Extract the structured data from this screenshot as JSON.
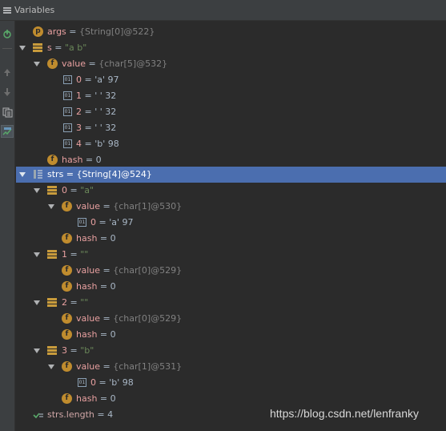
{
  "panel": {
    "title": "Variables"
  },
  "toolbar": {
    "icons": [
      "add-watch-icon",
      "up-arrow-icon",
      "down-arrow-icon",
      "copy-icon",
      "watches-icon"
    ]
  },
  "rows": {
    "args": {
      "name": "args",
      "eq": " = ",
      "value": "{String[0]@522}"
    },
    "s": {
      "name": "s",
      "eq": " = ",
      "value": "\"a  b\""
    },
    "s_value": {
      "name": "value",
      "eq": " = ",
      "value": "{char[5]@532}"
    },
    "s_v0": {
      "name": "0",
      "eq": " = ",
      "value": "'a' 97"
    },
    "s_v1": {
      "name": "1",
      "eq": " = ",
      "value": "' ' 32"
    },
    "s_v2": {
      "name": "2",
      "eq": " = ",
      "value": "' ' 32"
    },
    "s_v3": {
      "name": "3",
      "eq": " = ",
      "value": "' ' 32"
    },
    "s_v4": {
      "name": "4",
      "eq": " = ",
      "value": "'b' 98"
    },
    "s_hash": {
      "name": "hash",
      "eq": " = ",
      "value": "0"
    },
    "strs": {
      "name": "strs",
      "eq": " = ",
      "value": "{String[4]@524}"
    },
    "strs0": {
      "name": "0",
      "eq": " = ",
      "value": "\"a\""
    },
    "strs0_value": {
      "name": "value",
      "eq": " = ",
      "value": "{char[1]@530}"
    },
    "strs0_v0": {
      "name": "0",
      "eq": " = ",
      "value": "'a' 97"
    },
    "strs0_hash": {
      "name": "hash",
      "eq": " = ",
      "value": "0"
    },
    "strs1": {
      "name": "1",
      "eq": " = ",
      "value": "\"\""
    },
    "strs1_value": {
      "name": "value",
      "eq": " = ",
      "value": "{char[0]@529}"
    },
    "strs1_hash": {
      "name": "hash",
      "eq": " = ",
      "value": "0"
    },
    "strs2": {
      "name": "2",
      "eq": " = ",
      "value": "\"\""
    },
    "strs2_value": {
      "name": "value",
      "eq": " = ",
      "value": "{char[0]@529}"
    },
    "strs2_hash": {
      "name": "hash",
      "eq": " = ",
      "value": "0"
    },
    "strs3": {
      "name": "3",
      "eq": " = ",
      "value": "\"b\""
    },
    "strs3_value": {
      "name": "value",
      "eq": " = ",
      "value": "{char[1]@531}"
    },
    "strs3_v0": {
      "name": "0",
      "eq": " = ",
      "value": "'b' 98"
    },
    "strs3_hash": {
      "name": "hash",
      "eq": " = ",
      "value": "0"
    },
    "strs_length": {
      "name": "strs.length",
      "eq": " = ",
      "value": "4"
    }
  },
  "icon_letters": {
    "param": "p",
    "field": "f"
  },
  "watermark": "https://blog.csdn.net/lenfranky",
  "colors": {
    "selection": "#4b6eaf",
    "background": "#2b2b2b",
    "field_icon": "#c08c2e"
  }
}
